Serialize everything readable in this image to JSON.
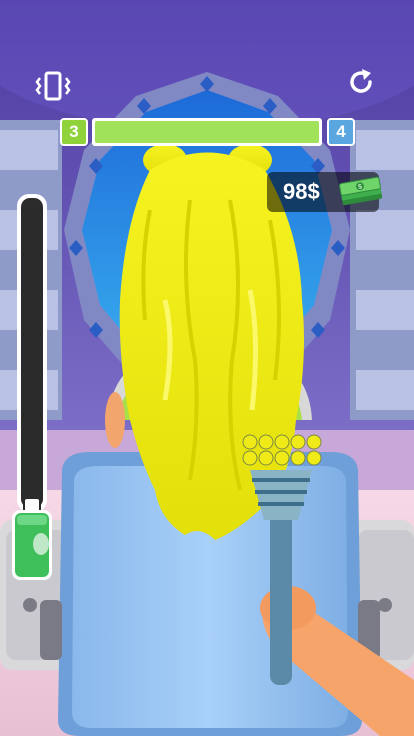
{
  "hud": {
    "level_current": "3",
    "level_next": "4",
    "level_progress": 1.0,
    "money": "98$",
    "vibration_icon": "vibration-icon",
    "restart_icon": "restart-icon",
    "money_icon": "cash-stack-icon"
  },
  "meter": {
    "fill_fraction": 0.0,
    "bottle_icon": "spray-bottle-icon"
  },
  "colors": {
    "hair": "#f2ee14",
    "progress_fill": "#a0e25a",
    "level_current_bg": "#8fd23a",
    "level_next_bg": "#5aa6e0",
    "bottle": "#3fbf5a"
  }
}
